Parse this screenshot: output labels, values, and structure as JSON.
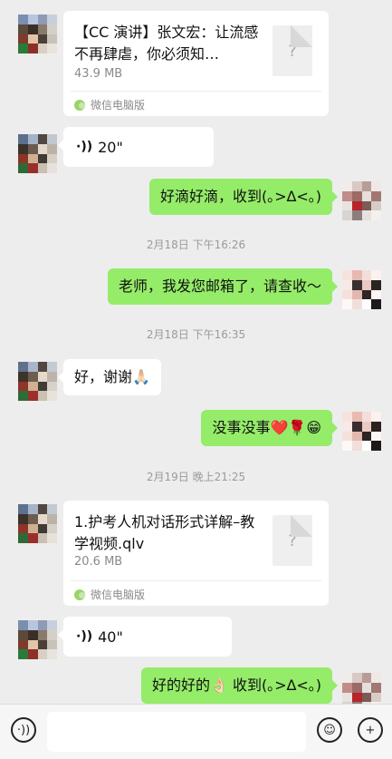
{
  "messages": {
    "file1": {
      "title": "【CC 演讲】张文宏：让流感不再肆虐，你必须知…",
      "size": "43.9 MB",
      "source": "微信电脑版",
      "icon": "?"
    },
    "voice1": {
      "duration": "20\""
    },
    "out1": {
      "text": "好滴好滴，收到(｡>∆<｡)"
    },
    "ts1": "2月18日 下午16:26",
    "out2": {
      "text": "老师，我发您邮箱了，请查收～"
    },
    "ts2": "2月18日 下午16:35",
    "in1": {
      "text": "好，谢谢🙏🏻"
    },
    "out3": {
      "text": "没事没事❤️🌹😁"
    },
    "ts3": "2月19日 晚上21:25",
    "file2": {
      "title": "1.护考人机对话形式详解–教学视频.qlv",
      "size": "20.6 MB",
      "source": "微信电脑版",
      "icon": "?"
    },
    "voice2": {
      "duration": "40\""
    },
    "out4": {
      "text": "好的好的👌🏻 收到(｡>∆<｡)"
    }
  },
  "inputbar": {
    "placeholder": ""
  }
}
